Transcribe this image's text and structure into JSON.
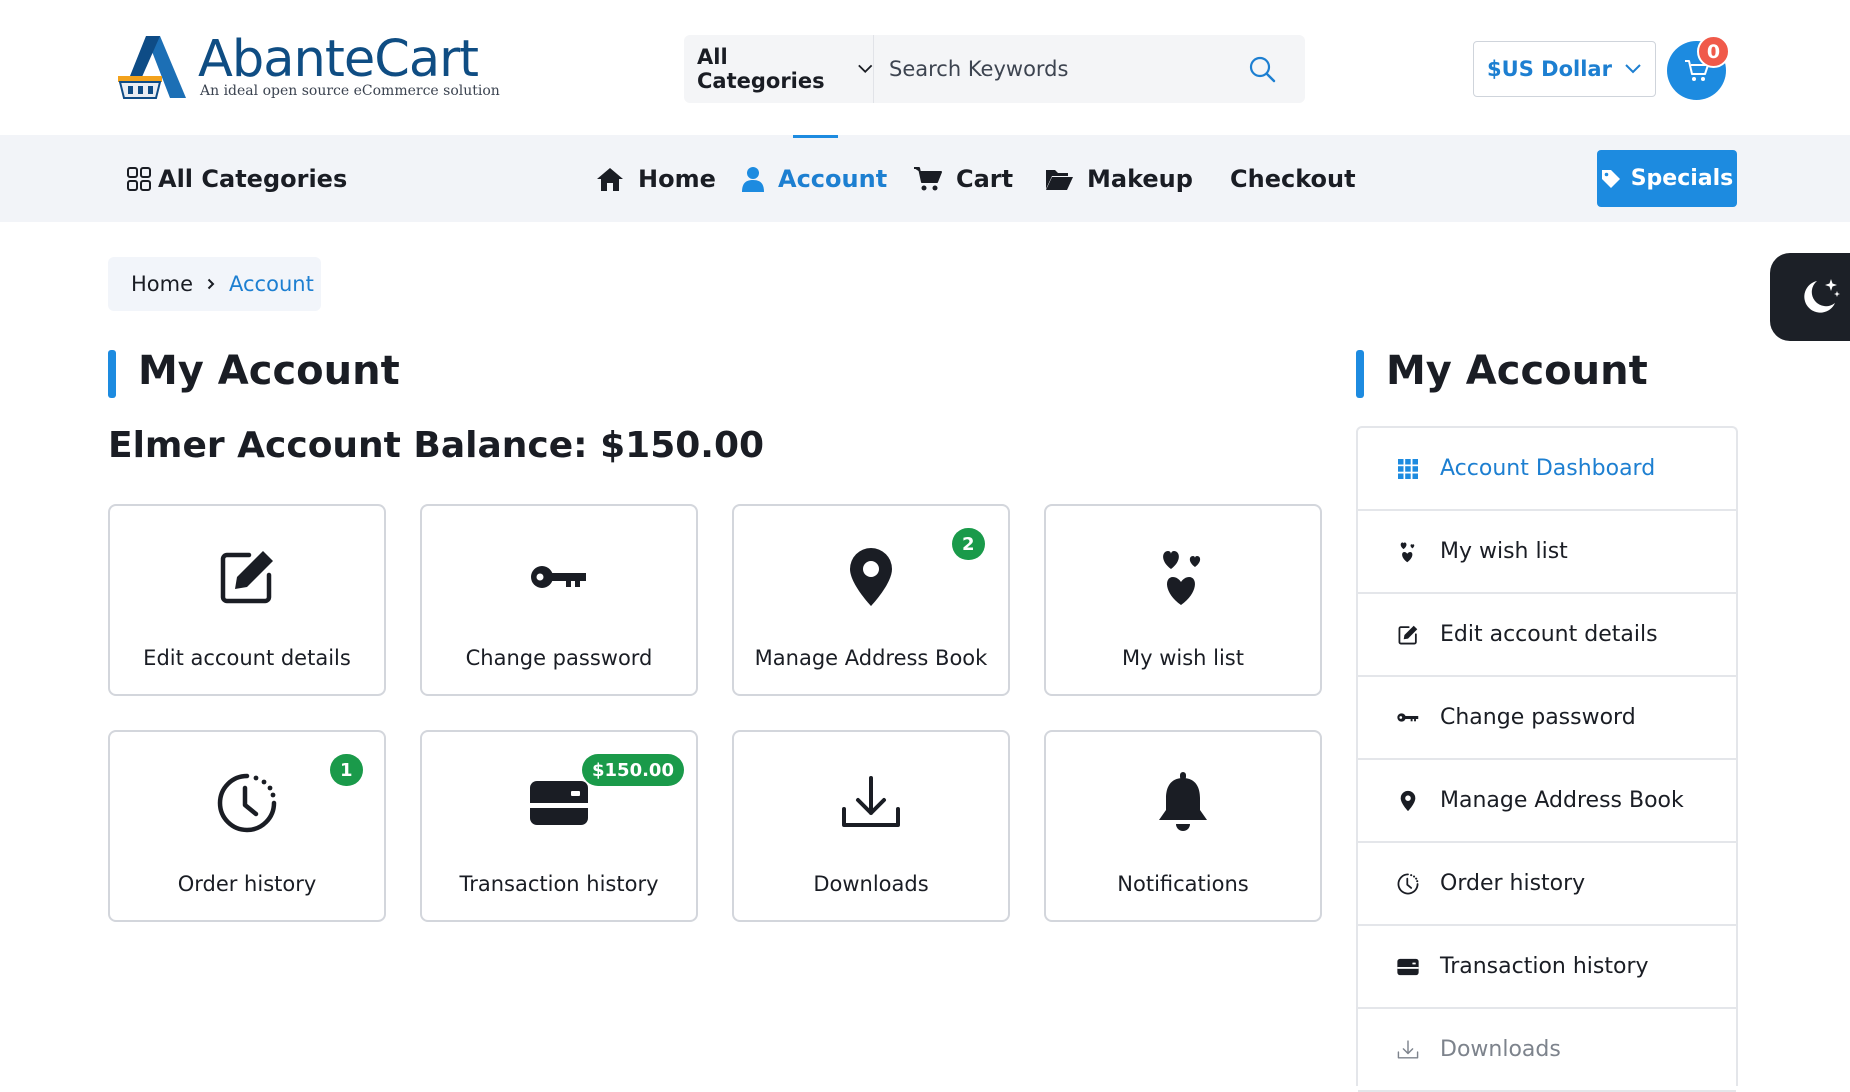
{
  "header": {
    "logo": {
      "title": "AbanteCart",
      "subtitle": "An ideal open source eCommerce solution"
    },
    "search": {
      "category_label": "All Categories",
      "placeholder": "Search Keywords"
    },
    "currency_label": "$US Dollar",
    "cart_count": "0"
  },
  "nav": {
    "all_categories_label": "All Categories",
    "items": [
      {
        "label": "Home",
        "icon": "home-icon"
      },
      {
        "label": "Account",
        "icon": "user-icon",
        "active": true
      },
      {
        "label": "Cart",
        "icon": "cart-icon"
      },
      {
        "label": "Makeup",
        "icon": "folder-icon"
      },
      {
        "label": "Checkout"
      }
    ],
    "specials_label": "Specials"
  },
  "breadcrumb": {
    "home": "Home",
    "current": "Account"
  },
  "main": {
    "title": "My Account",
    "balance_text": "Elmer Account Balance: $150.00",
    "cards": [
      {
        "label": "Edit account details",
        "icon": "edit-icon"
      },
      {
        "label": "Change password",
        "icon": "key-icon"
      },
      {
        "label": "Manage Address Book",
        "icon": "map-pin-icon",
        "badge": "2"
      },
      {
        "label": "My wish list",
        "icon": "hearts-icon"
      },
      {
        "label": "Order history",
        "icon": "clock-icon",
        "badge": "1"
      },
      {
        "label": "Transaction history",
        "icon": "credit-card-icon",
        "badge": "$150.00"
      },
      {
        "label": "Downloads",
        "icon": "download-icon"
      },
      {
        "label": "Notifications",
        "icon": "bell-icon"
      }
    ]
  },
  "sidebar": {
    "title": "My Account",
    "items": [
      {
        "label": "Account Dashboard",
        "icon": "grid-icon",
        "active": true
      },
      {
        "label": "My wish list",
        "icon": "hearts-icon"
      },
      {
        "label": "Edit account details",
        "icon": "edit-icon"
      },
      {
        "label": "Change password",
        "icon": "key-icon"
      },
      {
        "label": "Manage Address Book",
        "icon": "map-pin-icon"
      },
      {
        "label": "Order history",
        "icon": "clock-icon"
      },
      {
        "label": "Transaction history",
        "icon": "credit-card-icon"
      },
      {
        "label": "Downloads",
        "icon": "download-icon"
      }
    ]
  },
  "colors": {
    "accent": "#1d8be0",
    "badge": "#1a9a4a",
    "cart_badge": "#f05a4a",
    "dark_toggle": "#1c2027"
  }
}
